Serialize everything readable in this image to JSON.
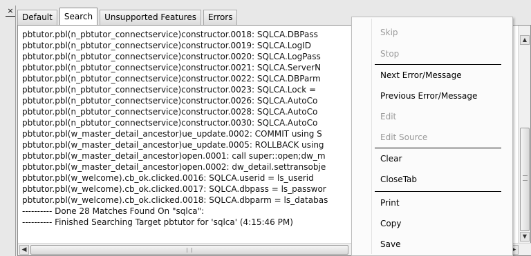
{
  "close_glyph": "×",
  "tabs": [
    {
      "label": "Default",
      "active": false
    },
    {
      "label": "Search",
      "active": true
    },
    {
      "label": "Unsupported Features",
      "active": false
    },
    {
      "label": "Errors",
      "active": false
    }
  ],
  "output_lines": [
    "pbtutor.pbl(n_pbtutor_connectservice)constructor.0018:  SQLCA.DBPass",
    "pbtutor.pbl(n_pbtutor_connectservice)constructor.0019:  SQLCA.LogID",
    "pbtutor.pbl(n_pbtutor_connectservice)constructor.0020:  SQLCA.LogPass",
    "pbtutor.pbl(n_pbtutor_connectservice)constructor.0021:  SQLCA.ServerN",
    "pbtutor.pbl(n_pbtutor_connectservice)constructor.0022:  SQLCA.DBParm",
    "pbtutor.pbl(n_pbtutor_connectservice)constructor.0023:  SQLCA.Lock    =",
    "pbtutor.pbl(n_pbtutor_connectservice)constructor.0026:    SQLCA.AutoCo",
    "pbtutor.pbl(n_pbtutor_connectservice)constructor.0028:    SQLCA.AutoCo",
    "pbtutor.pbl(n_pbtutor_connectservice)constructor.0030:    SQLCA.AutoCo",
    "pbtutor.pbl(w_master_detail_ancestor)ue_update.0002:  COMMIT using S",
    "pbtutor.pbl(w_master_detail_ancestor)ue_update.0005:  ROLLBACK using",
    "pbtutor.pbl(w_master_detail_ancestor)open.0001:  call super::open;dw_m",
    "pbtutor.pbl(w_master_detail_ancestor)open.0002:  dw_detail.settransobje",
    "pbtutor.pbl(w_welcome).cb_ok.clicked.0016:  SQLCA.userid = ls_userid",
    "pbtutor.pbl(w_welcome).cb_ok.clicked.0017:  SQLCA.dbpass = ls_passwor",
    "pbtutor.pbl(w_welcome).cb_ok.clicked.0018:  SQLCA.dbparm = ls_databas",
    " ---------- Done 28 Matches Found On \"sqlca\":",
    " ---------- Finished Searching Target pbtutor for 'sqlca'   (4:15:46 PM)"
  ],
  "context_menu": [
    {
      "label": "Skip",
      "enabled": false
    },
    {
      "label": "Stop",
      "enabled": false
    },
    {
      "label": "Next Error/Message",
      "enabled": true
    },
    {
      "label": "Previous Error/Message",
      "enabled": true
    },
    {
      "label": "Edit",
      "enabled": false
    },
    {
      "label": "Edit Source",
      "enabled": false
    },
    {
      "label": "Clear",
      "enabled": true
    },
    {
      "label": "CloseTab",
      "enabled": true
    },
    {
      "label": "Print",
      "enabled": true
    },
    {
      "label": "Copy",
      "enabled": true
    },
    {
      "label": "Save",
      "enabled": true
    }
  ],
  "scroll_glyphs": {
    "left": "◀",
    "right": "▶",
    "up": "▲",
    "down": "▼"
  },
  "colors": {
    "disabled_text": "#9a9a9a",
    "menu_bg": "#fbfbfb"
  }
}
